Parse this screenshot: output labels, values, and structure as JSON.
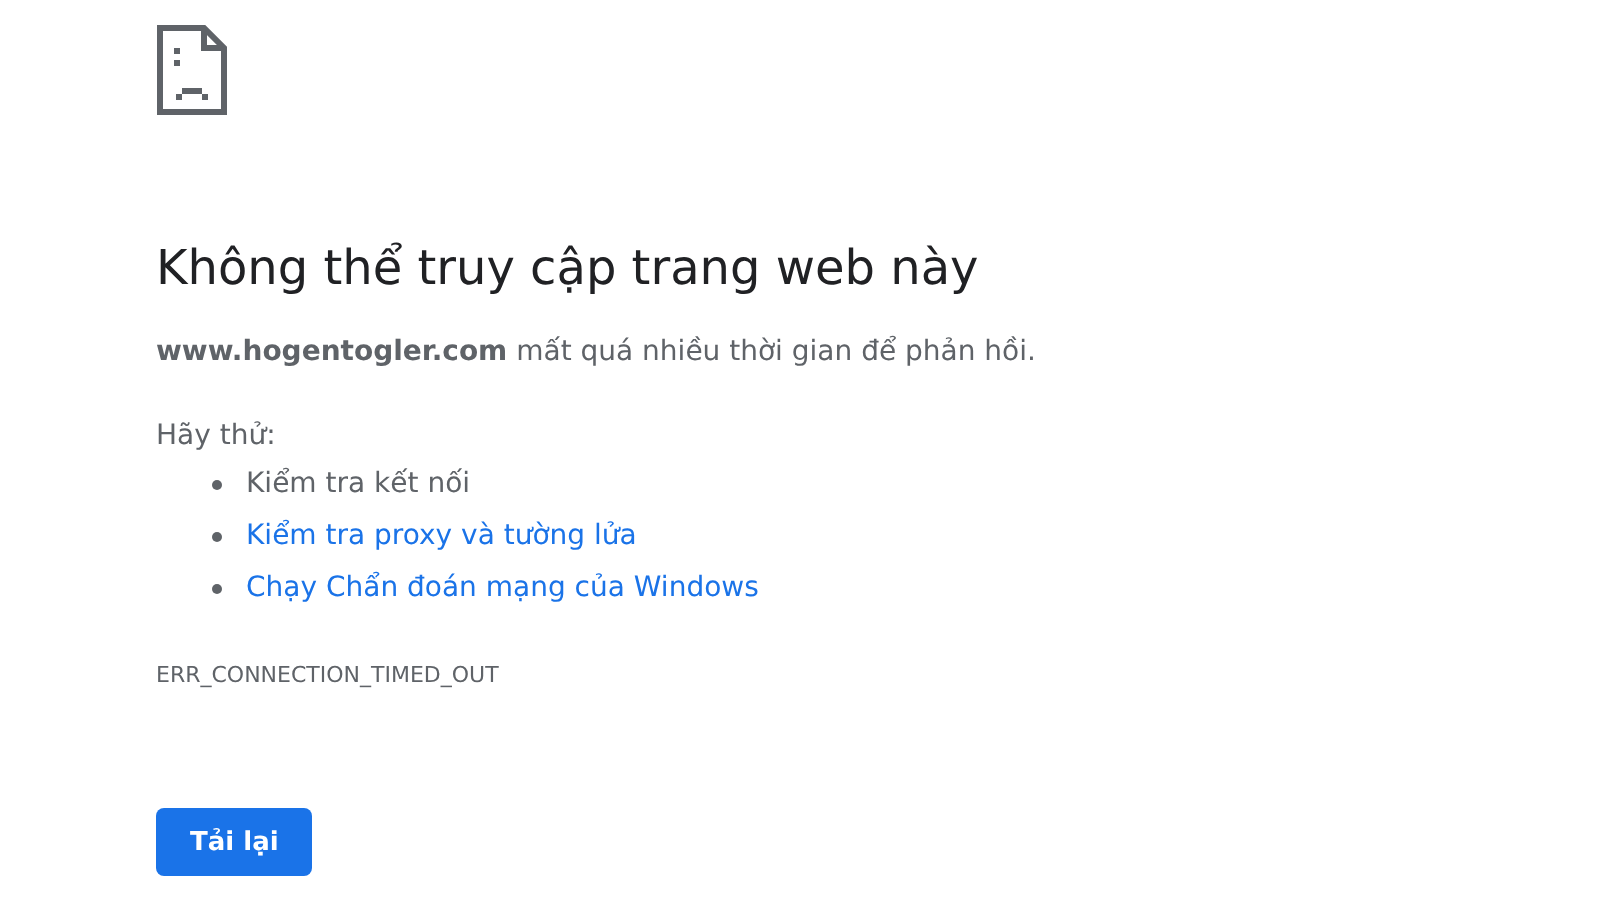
{
  "title": "Không thể truy cập trang web này",
  "description": "**www.hogentogler.com** mất quá nhiều thời gian để phản hồi.",
  "suggestions_heading": "Hãy thử:",
  "suggestions": [
    {
      "kind": "text",
      "label": "Kiểm tra kết nối"
    },
    {
      "kind": "link",
      "label": "Kiểm tra proxy và tường lửa"
    },
    {
      "kind": "link",
      "label": "Chạy Chẩn đoán mạng của Windows"
    }
  ],
  "error_code": "ERR_CONNECTION_TIMED_OUT",
  "reload_button": "Tải lại"
}
